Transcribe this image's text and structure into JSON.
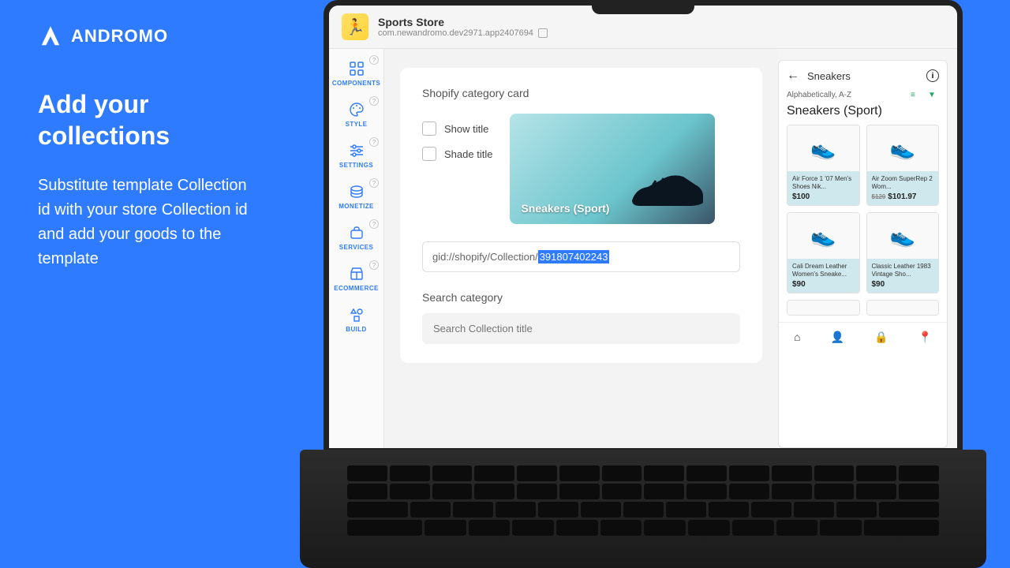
{
  "brand": {
    "name": "ANDROMO"
  },
  "headline": "Add your collections",
  "subtext": "Substitute template Collection id with your store Collection id and add your goods to the template",
  "app": {
    "title": "Sports Store",
    "package": "com.newandromo.dev2971.app2407694"
  },
  "sidebar": [
    {
      "label": "COMPONENTS"
    },
    {
      "label": "STYLE"
    },
    {
      "label": "SETTINGS"
    },
    {
      "label": "MONETIZE"
    },
    {
      "label": "SERVICES"
    },
    {
      "label": "ECOMMERCE"
    },
    {
      "label": "BUILD"
    }
  ],
  "editor": {
    "section_title": "Shopify category card",
    "show_title": "Show title",
    "shade_title": "Shade title",
    "preview_label": "Sneakers (Sport)",
    "gid_prefix": "gid://shopify/Collection/",
    "gid_value": "391807402243",
    "search_title": "Search category",
    "search_placeholder": "Search Collection title"
  },
  "phone": {
    "header": "Sneakers",
    "sort": "Alphabetically, A-Z",
    "category": "Sneakers (Sport)",
    "products": [
      {
        "name": "Air Force 1 '07 Men's Shoes Nik...",
        "price": "$100",
        "old": ""
      },
      {
        "name": "Air Zoom SuperRep 2 Wom...",
        "price": "$101.97",
        "old": "$120"
      },
      {
        "name": "Cali Dream Leather Women's Sneake...",
        "price": "$90",
        "old": ""
      },
      {
        "name": "Classic Leather 1983 Vintage Sho...",
        "price": "$90",
        "old": ""
      }
    ]
  }
}
